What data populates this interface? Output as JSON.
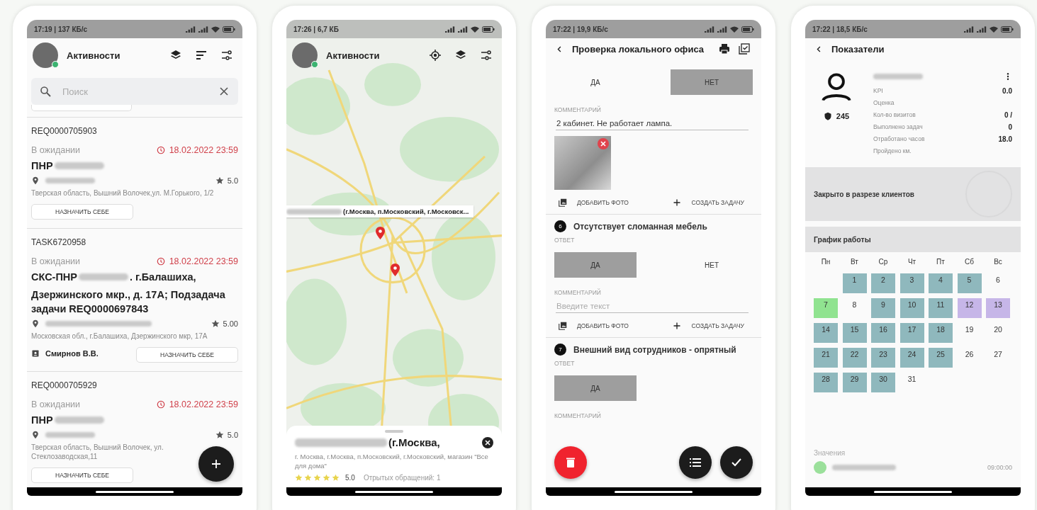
{
  "activities_list": {
    "status_bar": "17:19 | 137 КБ/с",
    "title": "Активности",
    "search": {
      "placeholder": "Поиск"
    },
    "cards": [
      {
        "id": "REQ0000705903",
        "status": "В ожидании",
        "due": "18.02.2022 23:59",
        "title": "ПНР",
        "rating": "5.0",
        "address": "Тверская область, Вышний Волочек,ул. М.Горького, 1/2",
        "action": "НАЗНАЧИТЬ СЕБЕ"
      },
      {
        "id": "TASK6720958",
        "status": "В ожидании",
        "due": "18.02.2022 23:59",
        "title": "СКС-ПНР",
        "title_rest": ". г.Балашиха,",
        "title_continued": "Дзержинского мкр., д. 17А; Подзадача задачи REQ0000697843",
        "rating": "5.00",
        "address": "Московская обл., г.Балашиха, Дзержинского мкр, 17А",
        "assignee": "Смирнов В.В.",
        "action": "НАЗНАЧИТЬ СЕБЕ"
      },
      {
        "id": "REQ0000705929",
        "status": "В ожидании",
        "due": "18.02.2022 23:59",
        "title": "ПНР",
        "rating": "5.0",
        "address": "Тверская область, Вышний Волочек, ул. Стеклозаводская,11",
        "action": "НАЗНАЧИТЬ СЕБЕ"
      }
    ]
  },
  "activities_map": {
    "status_bar": "17:26 | 6,7 КБ",
    "title": "Активности",
    "callout": "(г.Москва, п.Московский, г.Московск...",
    "place": {
      "title": "(г.Москва,",
      "address": "г. Москва, г.Москва, п.Московский, г.Московский, магазин \"Все для дома\"",
      "stars": 5,
      "rating": "5.0",
      "open_requests": "Отрытых обращений: 1"
    }
  },
  "checklist": {
    "status_bar": "17:22 | 19,9 КБ/с",
    "title": "Проверка локального офиса",
    "questions": [
      {
        "options": [
          {
            "label": "ДА",
            "selected": false
          },
          {
            "label": "НЕТ",
            "selected": true
          }
        ],
        "comment_label": "КОММЕНТАРИЙ",
        "comment": "2 кабинет. Не работает лампа.",
        "photo": true,
        "actions": [
          "ДОБАВИТЬ ФОТО",
          "СОЗДАТЬ ЗАДАЧУ"
        ]
      },
      {
        "number": "6",
        "text": "Отсутствует сломанная мебель",
        "answer_label": "ОТВЕТ",
        "options": [
          {
            "label": "ДА",
            "selected": true
          },
          {
            "label": "НЕТ",
            "selected": false
          }
        ],
        "comment_label": "КОММЕНТАРИЙ",
        "comment_placeholder": "Введите текст",
        "actions": [
          "ДОБАВИТЬ ФОТО",
          "СОЗДАТЬ ЗАДАЧУ"
        ]
      },
      {
        "number": "7",
        "text": "Внешний вид сотрудников - опрятный",
        "answer_label": "ОТВЕТ",
        "options": [
          {
            "label": "ДА",
            "selected": true
          }
        ],
        "comment_label": "КОММЕНТАРИЙ"
      }
    ]
  },
  "indicators": {
    "status_bar": "17:22 | 18,5 КБ/с",
    "title": "Показатели",
    "badge": "245",
    "metrics": [
      {
        "label": "KPI",
        "value": "0.0"
      },
      {
        "label": "Оценка"
      },
      {
        "label": "Кол-во визитов",
        "value": "0 /"
      },
      {
        "label": "Выполнено задач",
        "value": "0"
      },
      {
        "label": "Отработано часов",
        "value": "18.0"
      },
      {
        "label": "Пройдено км."
      }
    ],
    "closed_by_clients": "Закрыто в разрезе клиентов",
    "schedule": {
      "title": "График работы",
      "weekdays": [
        "Пн",
        "Вт",
        "Ср",
        "Чт",
        "Пт",
        "Сб",
        "Вс"
      ],
      "days": [
        {
          "kind": "blank"
        },
        {
          "kind": "day",
          "day": "1",
          "color": "#8fb8bd"
        },
        {
          "kind": "day",
          "day": "2",
          "color": "#8fb8bd"
        },
        {
          "kind": "day",
          "day": "3",
          "color": "#8fb8bd"
        },
        {
          "kind": "day",
          "day": "4",
          "color": "#8fb8bd"
        },
        {
          "kind": "day",
          "day": "5",
          "color": "#8fb8bd"
        },
        {
          "kind": "day",
          "day": "6"
        },
        {
          "kind": "day",
          "day": "7",
          "color": "#90e390"
        },
        {
          "kind": "day",
          "day": "8"
        },
        {
          "kind": "day",
          "day": "9",
          "color": "#8fb8bd"
        },
        {
          "kind": "day",
          "day": "10",
          "color": "#8fb8bd"
        },
        {
          "kind": "day",
          "day": "11",
          "color": "#8fb8bd"
        },
        {
          "kind": "day",
          "day": "12",
          "color": "#c6b6e8"
        },
        {
          "kind": "day",
          "day": "13",
          "color": "#c6b6e8"
        },
        {
          "kind": "day",
          "day": "14",
          "color": "#8fb8bd"
        },
        {
          "kind": "day",
          "day": "15",
          "color": "#8fb8bd"
        },
        {
          "kind": "day",
          "day": "16",
          "color": "#8fb8bd"
        },
        {
          "kind": "day",
          "day": "17",
          "color": "#8fb8bd"
        },
        {
          "kind": "day",
          "day": "18",
          "color": "#8fb8bd"
        },
        {
          "kind": "day",
          "day": "19"
        },
        {
          "kind": "day",
          "day": "20"
        },
        {
          "kind": "day",
          "day": "21",
          "color": "#8fb8bd"
        },
        {
          "kind": "day",
          "day": "22",
          "color": "#8fb8bd"
        },
        {
          "kind": "day",
          "day": "23",
          "color": "#8fb8bd"
        },
        {
          "kind": "day",
          "day": "24",
          "color": "#8fb8bd"
        },
        {
          "kind": "day",
          "day": "25",
          "color": "#8fb8bd"
        },
        {
          "kind": "day",
          "day": "26"
        },
        {
          "kind": "day",
          "day": "27"
        },
        {
          "kind": "day",
          "day": "28",
          "color": "#8fb8bd"
        },
        {
          "kind": "day",
          "day": "29",
          "color": "#8fb8bd"
        },
        {
          "kind": "day",
          "day": "30",
          "color": "#8fb8bd"
        },
        {
          "kind": "day",
          "day": "31"
        }
      ]
    },
    "values_label": "Значения",
    "value_time": "09:00:00"
  }
}
